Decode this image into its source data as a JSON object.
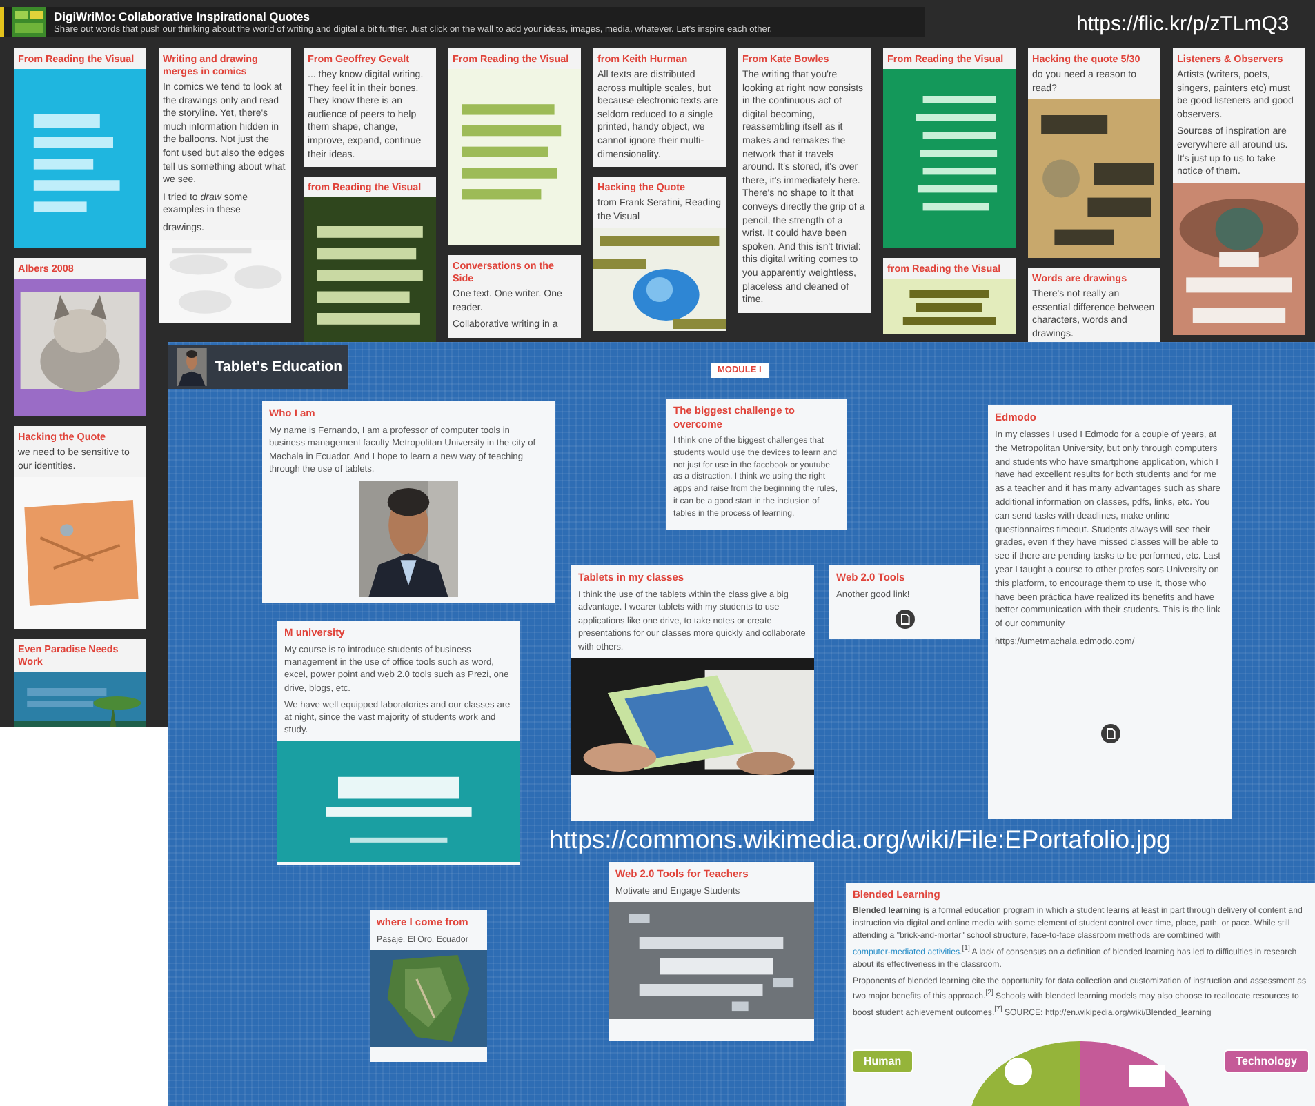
{
  "wall": {
    "title": "DigiWriMo: Collaborative Inspirational Quotes",
    "subtitle": "Share out words that push our thinking about the world of writing and digital a bit further. Just click on the wall to add your ideas, images, media, whatever. Let's inspire each other.",
    "attribution": "https://flic.kr/p/zTLmQ3",
    "columns": [
      [
        {
          "title": "From Reading the Visual",
          "media": {
            "kind": "picture"
          }
        },
        {
          "title": "Albers 2008",
          "media": {
            "kind": "picture"
          }
        },
        {
          "title": "Hacking the Quote",
          "paragraphs": [
            "we need to be sensitive to our identities."
          ],
          "media": {
            "kind": "picture"
          }
        },
        {
          "title": "Even Paradise Needs Work",
          "media": {
            "kind": "picture"
          }
        }
      ],
      [
        {
          "title": "Writing and drawing merges in comics",
          "paragraphs": [
            "In comics we tend to look at the drawings only and read the storyline. Yet, there's much information hidden in the balloons. Not just the font used but also the edges tell us something about what we see.",
            "I tried to *draw* some examples in these",
            "drawings."
          ],
          "media": {
            "kind": "picture"
          }
        }
      ],
      [
        {
          "title": "From Geoffrey Gevalt",
          "paragraphs": [
            "... they know digital writing. They feel it in their bones. They know there is an audience of peers to help them shape, change, improve, expand, continue their ideas."
          ]
        },
        {
          "title": "from Reading the Visual",
          "media": {
            "kind": "picture"
          }
        }
      ],
      [
        {
          "title": "From Reading the Visual",
          "media": {
            "kind": "picture"
          }
        },
        {
          "title": "Conversations on the Side",
          "paragraphs": [
            "One text. One writer. One reader.",
            "Collaborative writing in a"
          ]
        }
      ],
      [
        {
          "title": "from Keith Hurman",
          "paragraphs": [
            "All texts are distributed across multiple scales, but because electronic texts are seldom reduced to a single printed, handy object, we cannot ignore their multi-dimensionality."
          ]
        },
        {
          "title": "Hacking the Quote",
          "paragraphs": [
            "from Frank Serafini, Reading the Visual"
          ],
          "media": {
            "kind": "picture"
          }
        }
      ],
      [
        {
          "title": "From Kate Bowles",
          "paragraphs": [
            "The writing that you're looking at right now consists in the continuous act of digital becoming, reassembling itself as it makes and remakes the network that it travels around. It's stored, it's over there, it's immediately here. There's no shape to it that conveys directly the grip of a pencil, the strength of a wrist. It could have been spoken. And this isn't trivial: this digital writing comes to you apparently weightless, placeless and cleaned of time."
          ]
        }
      ],
      [
        {
          "title": "From Reading the Visual",
          "media": {
            "kind": "picture"
          }
        },
        {
          "title": "from Reading the Visual",
          "media": {
            "kind": "picture"
          }
        }
      ],
      [
        {
          "title": "Hacking the quote 5/30",
          "paragraphs": [
            "do you need a reason to read?"
          ],
          "media": {
            "kind": "picture"
          }
        },
        {
          "title": "Words are drawings",
          "paragraphs": [
            "There's not really an essential difference between characters, words and drawings."
          ]
        }
      ],
      [
        {
          "title": "Listeners & Observers",
          "paragraphs": [
            "Artists (writers, poets, singers, painters etc) must be good listeners and good observers.",
            "Sources of inspiration are everywhere all around us. It's just up to us to take notice of them."
          ],
          "media": {
            "kind": "picture"
          }
        }
      ]
    ]
  },
  "board": {
    "title": "Tablet's Education",
    "module_label": "MODULE I",
    "attribution": "https://commons.wikimedia.org/wiki/File:EPortafolio.jpg",
    "posts": [
      {
        "title": "Who I am",
        "paragraphs": [
          "My name is Fernando, I am a professor of computer tools in business management faculty Metropolitan University in the city of Machala in Ecuador. And I hope to learn a new way of teaching through the use of tablets."
        ],
        "media": {
          "kind": "picture"
        }
      },
      {
        "title": "M university",
        "paragraphs": [
          "My course is to introduce students of business management in the use of office tools such as word, excel, power point and web 2.0 tools such as Prezi, one drive, blogs, etc.",
          "We have well equipped laboratories and our classes are at night, since the vast majority of students work and study."
        ],
        "media": {
          "kind": "picture"
        }
      },
      {
        "title": "where I come from",
        "paragraphs": [
          "Pasaje, El Oro, Ecuador"
        ],
        "media": {
          "kind": "picture"
        }
      },
      {
        "title": "The biggest challenge to overcome",
        "paragraphs": [
          "I think one of the biggest challenges that students would use the devices to learn and not just for use in the facebook or youtube as a distraction. I think we using the right apps and raise from the beginning the rules, it can be a good start in the inclusion of tables in the process of learning."
        ]
      },
      {
        "title": "Tablets in my classes",
        "paragraphs": [
          "I think the use of the tablets within the class give a big advantage. I wearer tablets with my students to use applications like one drive, to take notes or create presentations for our classes more quickly and collaborate with others."
        ],
        "media": {
          "kind": "picture"
        }
      },
      {
        "title": "Web 2.0 Tools for Teachers",
        "paragraphs": [
          "Motivate and Engage Students"
        ],
        "media": {
          "kind": "picture"
        }
      },
      {
        "title": "Web 2.0 Tools",
        "paragraphs": [
          "Another good link!"
        ],
        "media": {
          "kind": "file"
        }
      },
      {
        "title": "Edmodo",
        "paragraphs": [
          "In my classes I used I Edmodo for a couple of years, at the Metropolitan University, but only through computers and students who have smartphone application, which I have had excellent results for both students and for me as a teacher and it has many advantages such as share additional information on classes, pdfs, links, etc. You can send tasks with deadlines, make online questionnaires timeout. Students always will see their grades, even if they have missed classes will be able to see if there are pending tasks to be performed, etc. Last year I taught a course to other profes sors University on this platform, to encourage them to use it, those who have been práctica have realized its benefits and have better communication with their students. This is the link of our community",
          "https://umetmachala.edmodo.com/"
        ],
        "media": {
          "kind": "file"
        }
      },
      {
        "title": "Blended Learning",
        "paragraphs": [
          [
            {
              "kind": "text",
              "text": "**Blended learning** is a formal education program in which a student learns at least in part through delivery of content and instruction via digital and online media with some element of student control over time, place, path, or pace. While still attending a \"brick-and-mortar\" school structure, face-to-face classroom methods are combined with "
            },
            {
              "kind": "link",
              "text": "computer-mediated activities."
            },
            {
              "kind": "text",
              "text": "$^{[1]}$ A lack of consensus on a definition of blended learning has led to difficulties in research about its effectiveness in the classroom."
            }
          ],
          "Proponents of blended learning cite the opportunity for data collection and customization of instruction and assessment as two major benefits of this approach.$^{[2]}$ Schools with blended learning models may also choose to reallocate resources to boost student achievement outcomes.$^{[7]}$ SOURCE: http://en.wikipedia.org/wiki/Blended_learning"
        ],
        "media": {
          "kind": "diagram",
          "labels": [
            "Human",
            "Technology"
          ]
        }
      }
    ]
  }
}
